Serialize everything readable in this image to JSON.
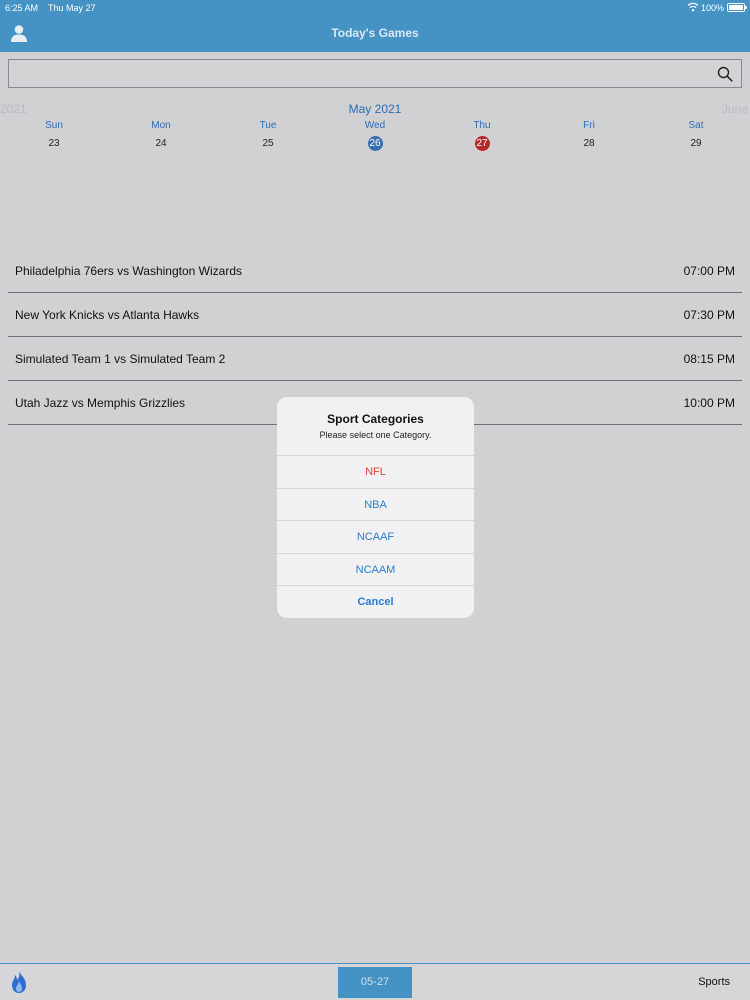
{
  "status_bar": {
    "time": "6:25 AM",
    "date": "Thu May 27",
    "battery": "100%",
    "battery_level": 1.0
  },
  "nav": {
    "title": "Today's Games",
    "profile_icon": "person-icon"
  },
  "search": {
    "value": "",
    "placeholder": "",
    "icon": "search-icon"
  },
  "calendar": {
    "prev_label": "2021",
    "month_label": "May 2021",
    "next_label": "June",
    "days": [
      {
        "dow": "Sun",
        "num": "23"
      },
      {
        "dow": "Mon",
        "num": "24"
      },
      {
        "dow": "Tue",
        "num": "25"
      },
      {
        "dow": "Wed",
        "num": "26"
      },
      {
        "dow": "Thu",
        "num": "27"
      },
      {
        "dow": "Fri",
        "num": "28"
      },
      {
        "dow": "Sat",
        "num": "29"
      }
    ],
    "today": "26",
    "selected": "27",
    "colors": {
      "today": "#3a6faf",
      "selected": "#b42a2a"
    }
  },
  "games": [
    {
      "matchup": "Philadelphia 76ers vs Washington Wizards",
      "time": "07:00 PM"
    },
    {
      "matchup": "New York Knicks vs Atlanta Hawks",
      "time": "07:30 PM"
    },
    {
      "matchup": "Simulated Team 1 vs Simulated Team 2",
      "time": "08:15 PM"
    },
    {
      "matchup": "Utah Jazz vs Memphis Grizzlies",
      "time": "10:00 PM"
    }
  ],
  "alert": {
    "title": "Sport Categories",
    "message": "Please select one Category.",
    "actions": [
      {
        "label": "NFL",
        "style": "destructive"
      },
      {
        "label": "NBA",
        "style": "default"
      },
      {
        "label": "NCAAF",
        "style": "default"
      },
      {
        "label": "NCAAM",
        "style": "default"
      },
      {
        "label": "Cancel",
        "style": "cancel"
      }
    ]
  },
  "bottom_bar": {
    "flame_icon": "flame-icon",
    "date_button": "05-27",
    "sports_label": "Sports"
  },
  "colors": {
    "accent": "#4592c4",
    "background": "#d1d1d4",
    "link_blue": "#2a7bd0",
    "destructive_red": "#e0453a"
  }
}
